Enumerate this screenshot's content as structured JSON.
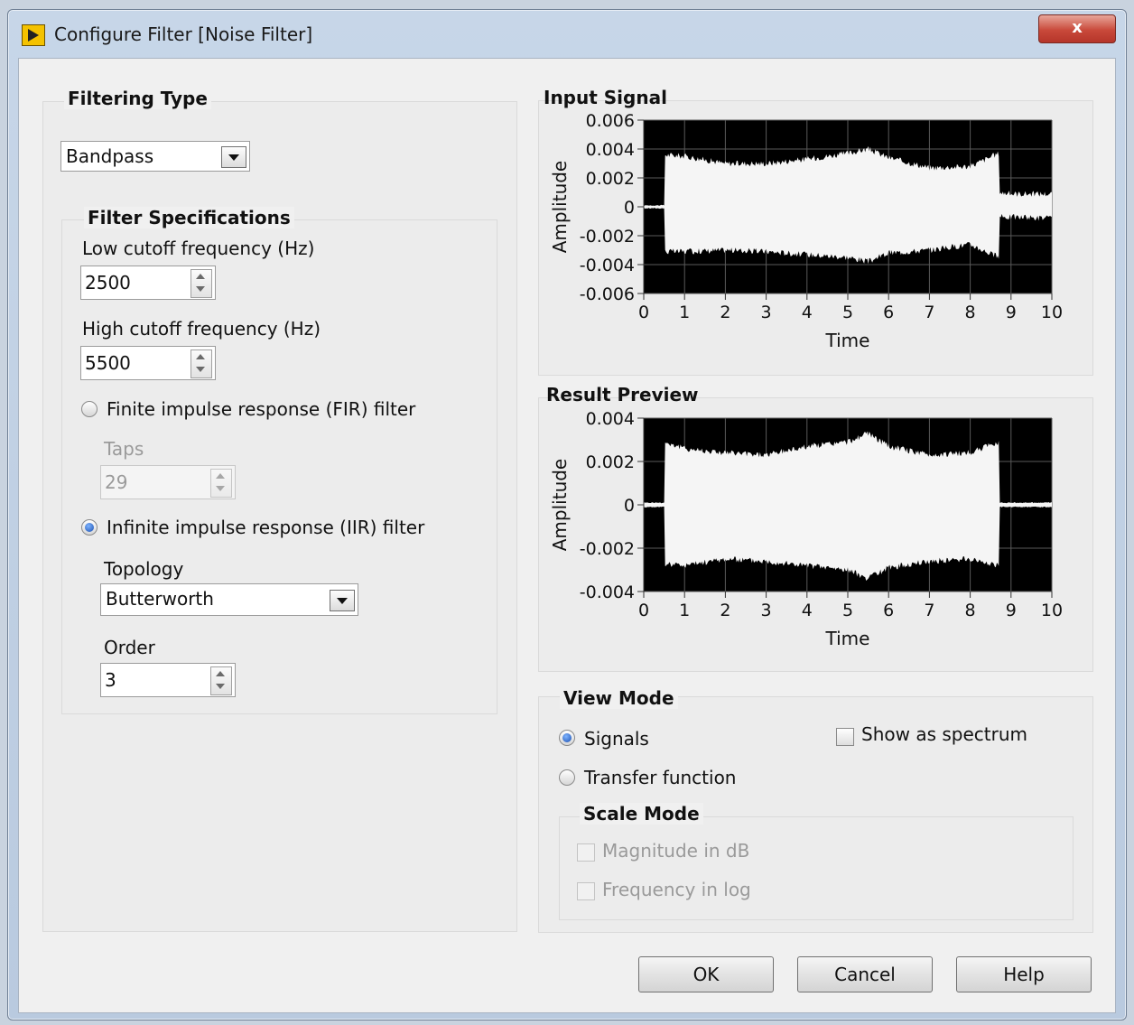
{
  "window": {
    "title": "Configure Filter [Noise Filter]",
    "close_label": "x"
  },
  "filtering_type": {
    "title": "Filtering Type",
    "selected": "Bandpass"
  },
  "filter_specs": {
    "title": "Filter Specifications",
    "low_cutoff_label": "Low cutoff frequency (Hz)",
    "low_cutoff_value": "2500",
    "high_cutoff_label": "High cutoff frequency (Hz)",
    "high_cutoff_value": "5500",
    "fir_label": "Finite impulse response (FIR) filter",
    "taps_label": "Taps",
    "taps_value": "29",
    "iir_label": "Infinite impulse response (IIR) filter",
    "topology_label": "Topology",
    "topology_value": "Butterworth",
    "order_label": "Order",
    "order_value": "3"
  },
  "view_mode": {
    "title": "View Mode",
    "signals_label": "Signals",
    "transfer_label": "Transfer function",
    "spectrum_label": "Show as spectrum",
    "scale_mode_title": "Scale Mode",
    "magnitude_db_label": "Magnitude in dB",
    "frequency_log_label": "Frequency in log"
  },
  "buttons": {
    "ok": "OK",
    "cancel": "Cancel",
    "help": "Help"
  },
  "chart_data": [
    {
      "type": "area",
      "title": "Input Signal",
      "xlabel": "Time",
      "ylabel": "Amplitude",
      "xlim": [
        0,
        10
      ],
      "ylim": [
        -0.006,
        0.006
      ],
      "x_ticks": [
        "0",
        "1",
        "2",
        "3",
        "4",
        "5",
        "6",
        "7",
        "8",
        "9",
        "10"
      ],
      "y_ticks": [
        "0.006",
        "0.004",
        "0.002",
        "0",
        "-0.002",
        "-0.004",
        "-0.006"
      ],
      "y_tick_values": [
        0.006,
        0.004,
        0.002,
        0,
        -0.002,
        -0.004,
        -0.006
      ],
      "background": "#000000",
      "series_color": "#f5f5f5",
      "grid": true,
      "envelope": {
        "x": [
          0,
          0.5,
          0.5,
          1,
          2,
          3,
          4,
          5,
          5.5,
          6,
          7,
          8,
          8.7,
          8.7,
          9,
          10
        ],
        "upper": [
          0.0001,
          0.0001,
          0.0036,
          0.0035,
          0.003,
          0.003,
          0.0033,
          0.0037,
          0.004,
          0.0034,
          0.0027,
          0.0028,
          0.0037,
          0.001,
          0.0009,
          0.0009
        ],
        "lower": [
          -0.0001,
          -0.0001,
          -0.0031,
          -0.0031,
          -0.003,
          -0.0031,
          -0.0033,
          -0.0035,
          -0.0038,
          -0.0032,
          -0.003,
          -0.0026,
          -0.0035,
          -0.0007,
          -0.0007,
          -0.0008
        ]
      }
    },
    {
      "type": "area",
      "title": "Result Preview",
      "xlabel": "Time",
      "ylabel": "Amplitude",
      "xlim": [
        0,
        10
      ],
      "ylim": [
        -0.004,
        0.004
      ],
      "x_ticks": [
        "0",
        "1",
        "2",
        "3",
        "4",
        "5",
        "6",
        "7",
        "8",
        "9",
        "10"
      ],
      "y_ticks": [
        "0.004",
        "0.002",
        "0",
        "-0.002",
        "-0.004"
      ],
      "y_tick_values": [
        0.004,
        0.002,
        0,
        -0.002,
        -0.004
      ],
      "background": "#000000",
      "series_color": "#f5f5f5",
      "grid": true,
      "envelope": {
        "x": [
          0,
          0.5,
          0.5,
          1,
          2,
          3,
          4,
          5,
          5.5,
          6,
          7,
          8,
          8.7,
          8.7,
          9,
          10
        ],
        "upper": [
          0.0001,
          0.0001,
          0.0029,
          0.0026,
          0.0024,
          0.0023,
          0.0027,
          0.0029,
          0.0033,
          0.0027,
          0.0023,
          0.0024,
          0.0029,
          0.0001,
          0.0001,
          0.0001
        ],
        "lower": [
          -0.0001,
          -0.0001,
          -0.0027,
          -0.0028,
          -0.0025,
          -0.0026,
          -0.0028,
          -0.003,
          -0.0034,
          -0.0029,
          -0.0026,
          -0.0025,
          -0.0028,
          -0.0001,
          -0.0001,
          -0.0001
        ]
      }
    }
  ]
}
